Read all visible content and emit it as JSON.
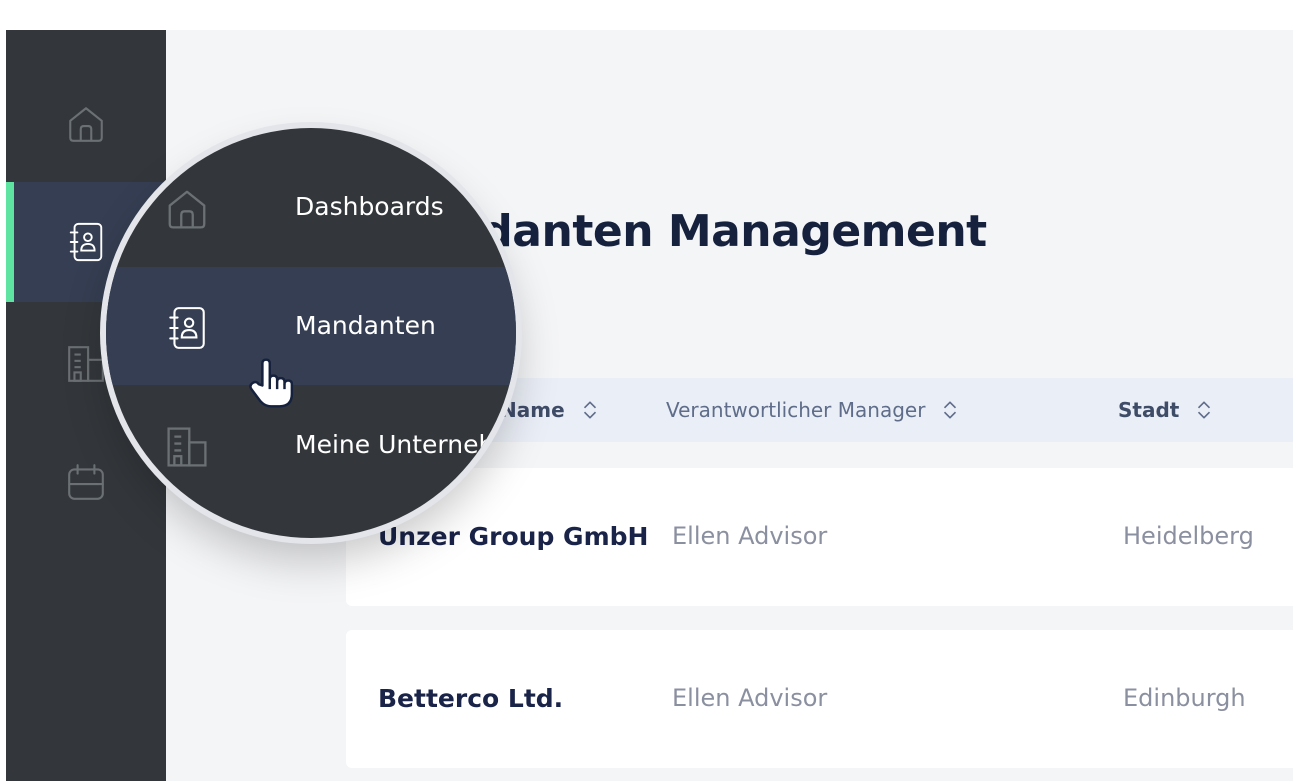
{
  "colors": {
    "sidebar": "#33373b",
    "sidebar_active": "#353e52",
    "accent": "#5fe3a1",
    "page_background": "#f4f5f7",
    "title_text": "#15213d"
  },
  "sidebar": {
    "items": [
      {
        "icon": "home-icon",
        "active": false
      },
      {
        "icon": "contacts-book-icon",
        "active": true
      },
      {
        "icon": "building-icon",
        "active": false
      },
      {
        "icon": "calendar-icon",
        "active": false
      }
    ]
  },
  "page": {
    "title": "Mandanten Management"
  },
  "table": {
    "columns": [
      {
        "label": "Name",
        "sort_icon": "sort-icon"
      },
      {
        "label": "Verantwortlicher Manager",
        "sort_icon": "sort-icon"
      },
      {
        "label": "Stadt",
        "sort_icon": "sort-icon"
      }
    ],
    "rows": [
      {
        "company": "Unzer Group GmbH",
        "manager": "Ellen Advisor",
        "city": "Heidelberg"
      },
      {
        "company": "Betterco Ltd.",
        "manager": "Ellen Advisor",
        "city": "Edinburgh"
      }
    ]
  },
  "magnifier": {
    "items": [
      {
        "label": "Dashboards",
        "icon": "home-icon"
      },
      {
        "label": "Mandanten",
        "icon": "contacts-book-icon",
        "active": true
      },
      {
        "label": "Meine Unternehmen",
        "icon": "building-icon"
      }
    ],
    "cursor_icon": "hand-pointer-icon"
  }
}
